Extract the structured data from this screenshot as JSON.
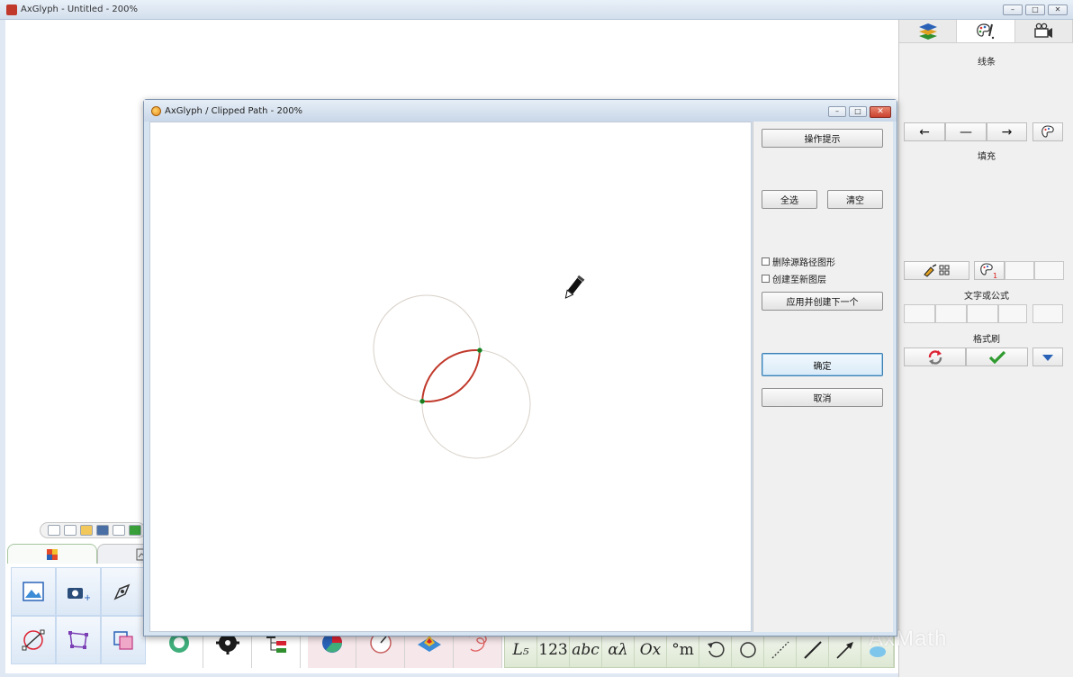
{
  "main_window": {
    "title": "AxGlyph - Untitled - 200%",
    "controls": {
      "minimize": "–",
      "maximize": "□",
      "close": "✕"
    }
  },
  "right_panel": {
    "tabs": [
      {
        "icon": "layers-icon"
      },
      {
        "icon": "palette-brush-icon"
      },
      {
        "icon": "camera-icon"
      }
    ],
    "line_label": "线条",
    "line_buttons": [
      "←",
      "—",
      "→"
    ],
    "fill_label": "填充",
    "text_formula_label": "文字或公式",
    "format_brush_label": "格式刷",
    "palette_badge": "1"
  },
  "dialog": {
    "title": "AxGlyph / Clipped Path - 200%",
    "hint_button": "操作提示",
    "select_all_button": "全选",
    "clear_button": "清空",
    "delete_source_label": "删除源路径图形",
    "new_layer_label": "创建至新图层",
    "apply_next_button": "应用并创建下一个",
    "ok_button": "确定",
    "cancel_button": "取消",
    "controls": {
      "minimize": "–",
      "maximize": "□",
      "close": "✕"
    }
  },
  "math_toolbar": {
    "items": [
      "L₅",
      "123",
      "abc",
      "αλ",
      "Ox",
      "°m"
    ]
  },
  "watermark": "AxMath",
  "colors": {
    "clip_stroke": "#c0392b",
    "circle_stroke": "#d8d0c8",
    "node_fill": "#1f7a1f",
    "accent_blue": "#3c7fb1"
  }
}
